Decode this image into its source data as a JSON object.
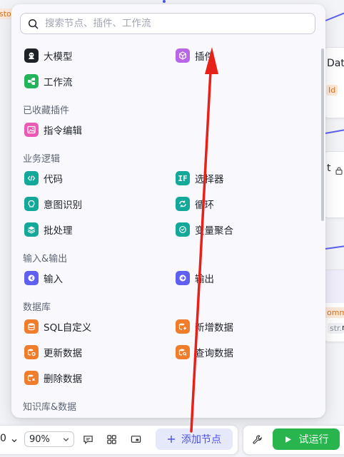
{
  "search": {
    "placeholder": "搜索节点、插件、工作流"
  },
  "top_items": [
    {
      "label": "大模型",
      "icon": "llm-icon"
    },
    {
      "label": "插件",
      "icon": "plugin-icon"
    },
    {
      "label": "工作流",
      "icon": "workflow-icon"
    }
  ],
  "sections": {
    "favorites": {
      "title": "已收藏插件",
      "items": [
        {
          "label": "指令编辑"
        }
      ]
    },
    "logic": {
      "title": "业务逻辑",
      "items": [
        {
          "label": "代码"
        },
        {
          "label": "选择器"
        },
        {
          "label": "意图识别"
        },
        {
          "label": "循环"
        },
        {
          "label": "批处理"
        },
        {
          "label": "变量聚合"
        }
      ]
    },
    "io": {
      "title": "输入&输出",
      "items": [
        {
          "label": "输入"
        },
        {
          "label": "输出"
        }
      ]
    },
    "database": {
      "title": "数据库",
      "items": [
        {
          "label": "SQL自定义"
        },
        {
          "label": "新增数据"
        },
        {
          "label": "更新数据"
        },
        {
          "label": "查询数据"
        },
        {
          "label": "删除数据"
        }
      ]
    },
    "knowledge": {
      "title": "知识库&数据"
    }
  },
  "canvas": {
    "partial_texts": [
      "Dat",
      "Id",
      "t",
      "omm",
      "str.",
      "m",
      "sto"
    ]
  },
  "toolbar": {
    "zoom": "90%",
    "add_node_label": "添加节点",
    "run_label": "试运行"
  },
  "colors": {
    "accent": "#4d53e8",
    "run_green": "#28b54d",
    "annotation_arrow": "#e8201a",
    "teal": "#14a89a",
    "orange": "#ef7d2b",
    "indigo": "#5f5ff0",
    "purple": "#b865e8",
    "pink": "#e85ab5",
    "green": "#22b35b"
  }
}
